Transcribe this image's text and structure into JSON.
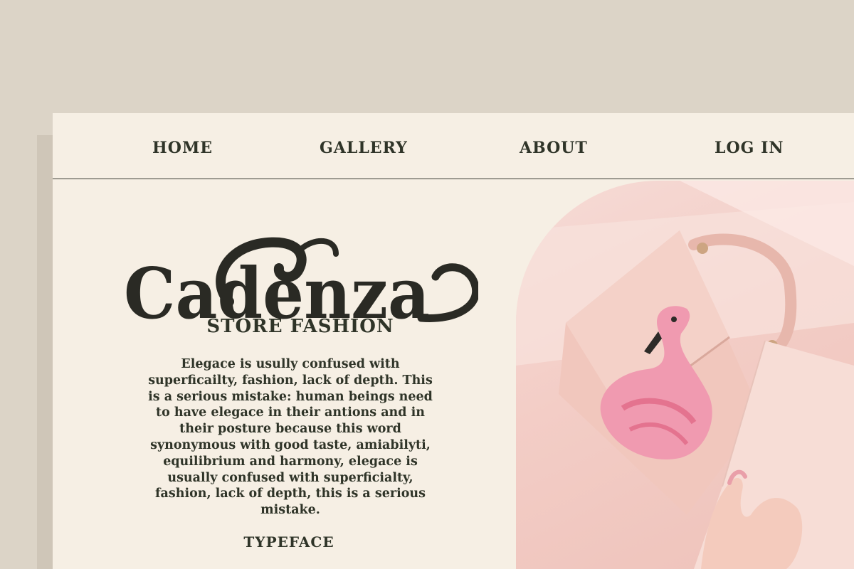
{
  "nav": {
    "home": "HOME",
    "gallery": "GALLERY",
    "about": "ABOUT",
    "login": "LOG IN"
  },
  "brand": {
    "logo_text": "Cadenza",
    "subtitle": "STORE FASHION"
  },
  "description": "Elegace is usully confused with superficailty, fashion, lack of depth. This is a serious mistake: human beings need to have elegace in their antions and in their posture because this word synonymous with good taste, amiabilyti, equilibrium and harmony, elegace is usually confused with superficialty, fashion, lack of depth, this is a serious mistake.",
  "footer_label": "TYPEFACE",
  "colors": {
    "background": "#dcd4c7",
    "page": "#f6efe4",
    "text": "#2f3428",
    "photo_pink": "#f3cdc6"
  },
  "hero_image": {
    "icon": "flamingo-handbag-photo"
  }
}
